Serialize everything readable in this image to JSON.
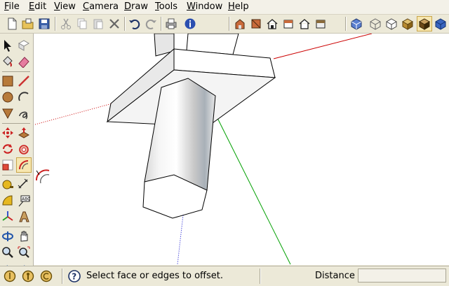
{
  "menu": [
    "File",
    "Edit",
    "View",
    "Camera",
    "Draw",
    "Tools",
    "Window",
    "Help"
  ],
  "menu_underline": [
    "F",
    "E",
    "V",
    "C",
    "D",
    "T",
    "W",
    "H"
  ],
  "toolbar_top": {
    "items": [
      "new-icon",
      "open-icon",
      "save-icon",
      "cut-icon",
      "copy-icon",
      "paste-icon",
      "erase-icon",
      "undo-icon",
      "redo-icon",
      "print-icon",
      "model-info-icon",
      "iso-view-icon",
      "top-view-icon",
      "front-view-icon",
      "right-view-icon",
      "back-view-icon",
      "left-view-icon",
      "xray-style-icon",
      "wireframe-style-icon",
      "hidden-line-style-icon",
      "shaded-style-icon",
      "shaded-textures-style-icon",
      "monochrome-style-icon"
    ]
  },
  "toolbar_left": {
    "items": [
      "select-icon",
      "make-component-icon",
      "paint-bucket-icon",
      "eraser-icon",
      "rectangle-icon",
      "line-icon",
      "circle-icon",
      "arc-icon",
      "polygon-icon",
      "freehand-icon",
      "move-icon",
      "push-pull-icon",
      "rotate-icon",
      "follow-me-icon",
      "scale-icon",
      "offset-icon",
      "tape-measure-icon",
      "dimension-icon",
      "protractor-icon",
      "text-icon",
      "axes-icon",
      "3d-text-icon",
      "orbit-icon",
      "pan-icon",
      "zoom-icon",
      "zoom-extents-icon",
      "previous-view-icon",
      "next-view-icon"
    ]
  },
  "status": {
    "message": "Select face or edges to offset.",
    "measure_label": "Distance",
    "measure_value": ""
  },
  "colors": {
    "axis_red": "#cc0000",
    "axis_green": "#00a000",
    "axis_blue": "#0000cc",
    "face_light": "#f2f2f2",
    "face_shade": "#d9d9d9",
    "edge": "#000000"
  }
}
